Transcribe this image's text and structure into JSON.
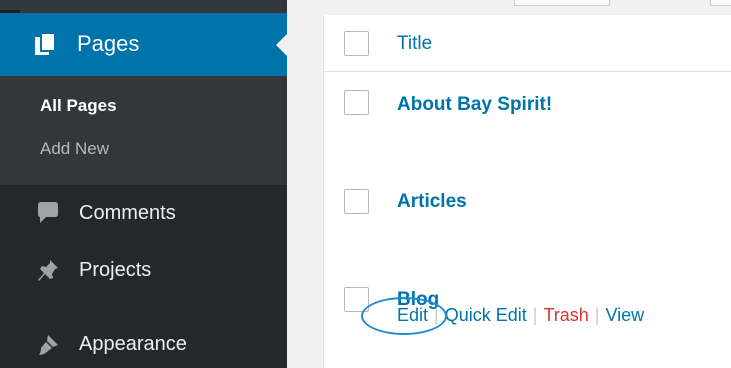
{
  "sidebar": {
    "active_menu": {
      "label": "Pages",
      "icon": "pages-icon"
    },
    "submenu": {
      "all_pages": "All Pages",
      "add_new": "Add New"
    },
    "items": [
      {
        "label": "Comments",
        "icon": "comments-icon"
      },
      {
        "label": "Projects",
        "icon": "pin-icon"
      },
      {
        "label": "Appearance",
        "icon": "paintbrush-icon"
      }
    ]
  },
  "table": {
    "header_title": "Title",
    "rows": [
      {
        "title": "About Bay Spirit!"
      },
      {
        "title": "Articles"
      },
      {
        "title": "Blog",
        "actions": {
          "edit": "Edit",
          "quick_edit": "Quick Edit",
          "trash": "Trash",
          "view": "View"
        },
        "separator": "|"
      }
    ]
  },
  "colors": {
    "sidebar_bg": "#23282d",
    "active_bg": "#0073aa",
    "link": "#0073aa",
    "trash": "#dc3232",
    "highlight_circle": "#1e8cd3"
  }
}
